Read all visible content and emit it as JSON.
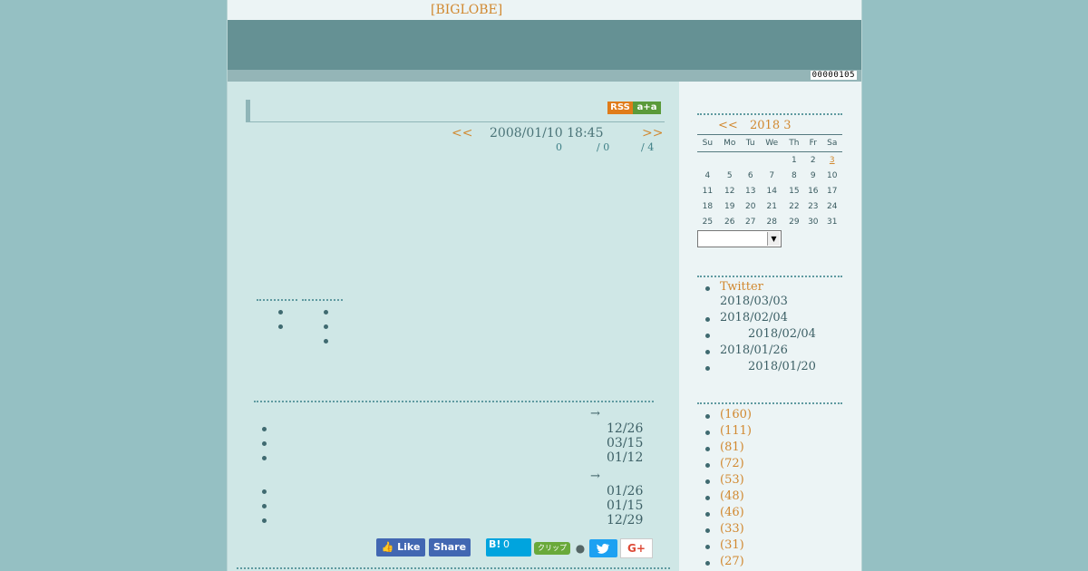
{
  "header": {
    "brand": "[BIGLOBE]",
    "counter": "00000105"
  },
  "entry": {
    "prev": "<<",
    "next": ">>",
    "datetime": "2008/01/10 18:45",
    "stats": [
      "0",
      "/ 0",
      "/ 4"
    ],
    "rss_label": "RSS",
    "a2a_label": "a+a"
  },
  "related": {
    "group1": {
      "arrow": "→",
      "dates": [
        "12/26",
        "03/15",
        "01/12"
      ]
    },
    "group2": {
      "arrow": "→",
      "dates": [
        "01/26",
        "01/15",
        "12/29"
      ]
    }
  },
  "share": {
    "like_label": "Like",
    "share_label": "Share",
    "hatena_label": "B!",
    "hatena_count": "0",
    "clip_label": "クリップ",
    "gplus_label": "G+"
  },
  "calendar": {
    "prev": "<<",
    "month": "2018 3",
    "weekdays": [
      "Su",
      "Mo",
      "Tu",
      "We",
      "Th",
      "Fr",
      "Sa"
    ],
    "weeks": [
      [
        "",
        "",
        "",
        "",
        "1",
        "2",
        "3"
      ],
      [
        "4",
        "5",
        "6",
        "7",
        "8",
        "9",
        "10"
      ],
      [
        "11",
        "12",
        "13",
        "14",
        "15",
        "16",
        "17"
      ],
      [
        "18",
        "19",
        "20",
        "21",
        "22",
        "23",
        "24"
      ],
      [
        "25",
        "26",
        "27",
        "28",
        "29",
        "30",
        "31"
      ]
    ],
    "today": "3"
  },
  "recent": [
    {
      "link": "Twitter",
      "date": "2018/03/03"
    },
    {
      "date": "2018/02/04"
    },
    {
      "date": "2018/02/04"
    },
    {
      "date": "2018/01/26"
    },
    {
      "date": "2018/01/20"
    }
  ],
  "categories": [
    "(160)",
    "(111)",
    "(81)",
    "(72)",
    "(53)",
    "(48)",
    "(46)",
    "(33)",
    "(31)",
    "(27)"
  ],
  "colors": {
    "accent": "#d1882f",
    "content_bg": "#cfe7e6",
    "banner": "#659194",
    "outer_bg": "#95c0c3"
  }
}
